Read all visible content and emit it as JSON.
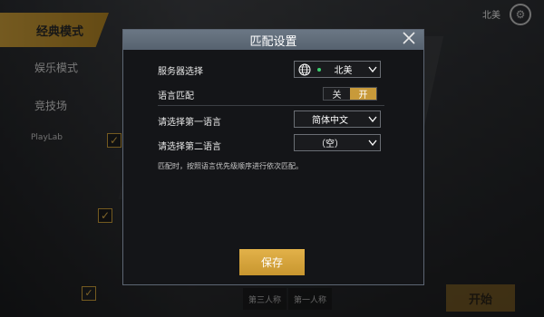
{
  "background": {
    "mode_tab": "经典模式",
    "side_items": [
      "娱乐模式",
      "竞技场"
    ],
    "side_small": "PlayLab",
    "top_region": "北美",
    "bottom_labels": [
      "第三人称",
      "第一人称"
    ],
    "start_label": "开始"
  },
  "dialog": {
    "title": "匹配设置",
    "server": {
      "label": "服务器选择",
      "value": "北美",
      "icon": "globe-icon",
      "ping_color": "#3ccf6e"
    },
    "language_match": {
      "label": "语言匹配",
      "off_label": "关",
      "on_label": "开",
      "state": "on"
    },
    "first_language": {
      "label": "请选择第一语言",
      "value": "简体中文"
    },
    "second_language": {
      "label": "请选择第二语言",
      "value": "（空）"
    },
    "hint": "匹配时，按照语言优先级顺序进行依次匹配。",
    "save_label": "保存"
  },
  "colors": {
    "accent": "#c89a3a",
    "header": "#5f6b79",
    "panel": "#141518"
  }
}
